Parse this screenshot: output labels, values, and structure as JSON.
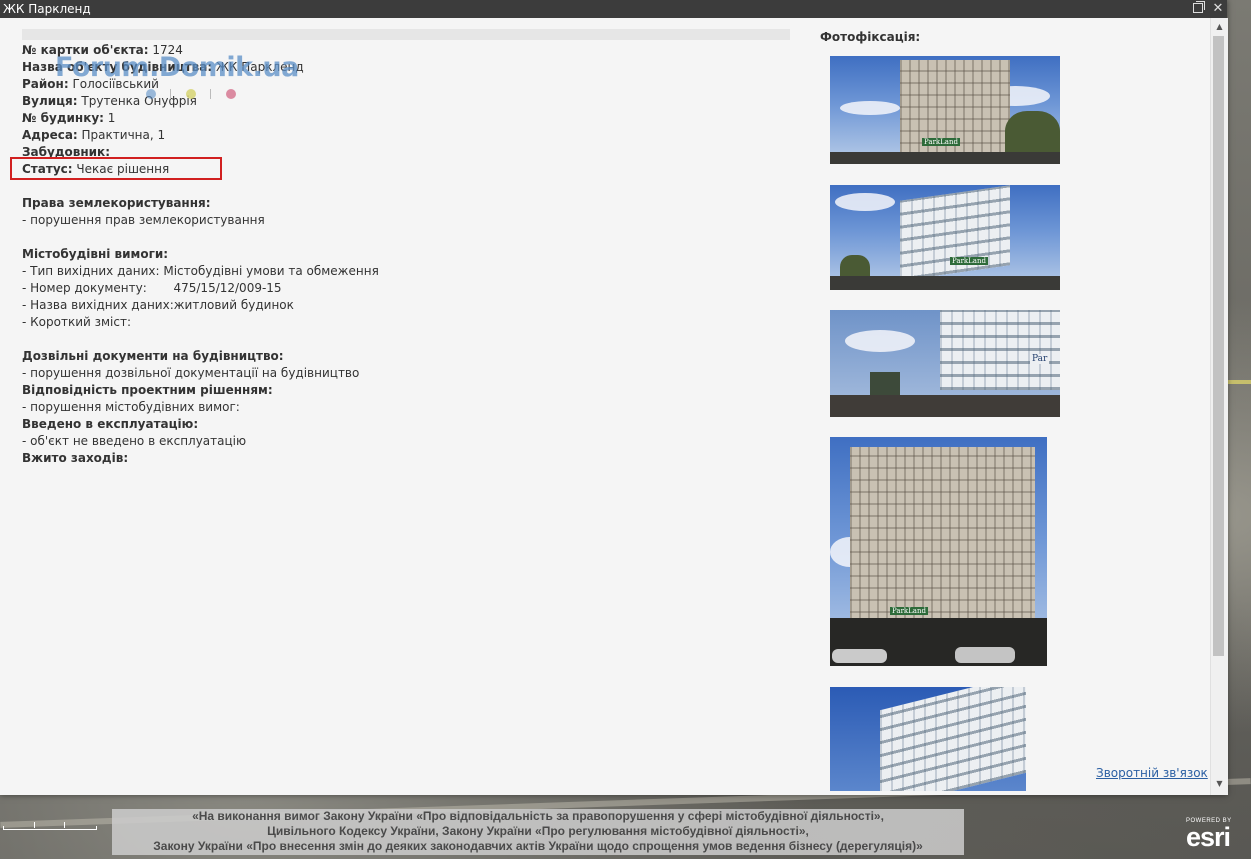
{
  "window": {
    "title": "ЖК Парклeнд",
    "maximize_icon": "restore-icon",
    "close_icon": "close-icon"
  },
  "watermark": {
    "text": "Forum.Domik.ua",
    "color": "#5b8fc7"
  },
  "info": {
    "card_number_label": "№ картки об'єкта:",
    "card_number_value": " 1724",
    "object_name_label": "Назва об'єкту будівництва:",
    "object_name_value": " ЖК Паркленд",
    "district_label": "Район:",
    "district_value": " Голосіївський",
    "street_label": "Вулиця:",
    "street_value": " Трутенка Онуфрія",
    "building_label": "№ будинку:",
    "building_value": " 1",
    "address_label": "Адреса:",
    "address_value": " Практична, 1",
    "developer_label": "Забудовник:",
    "status_label": "Статус:",
    "status_value": " Чекає рішення",
    "land_rights_heading": "Права землекористування:",
    "land_rights_item": "- порушення прав землекористування",
    "urban_requirements_heading": "Містобудівні вимоги:",
    "urban_type": "- Тип вихідних даних: Містобудівні умови та обмеження",
    "urban_doc_number": "- Номер документу:       475/15/12/009-15",
    "urban_name": "- Назва вихідних даних:житловий будинок",
    "urban_summary": "- Короткий зміст:",
    "permits_heading": "Дозвільні документи на будівництво:",
    "permits_item": "- порушення дозвільної документації на будівництво",
    "compliance_heading": "Відповідність проектним рішенням:",
    "compliance_item": "- порушення містобудівних вимог:",
    "commissioned_heading": "Введено в експлуатацію:",
    "commissioned_item": "- об'єкт не введено в експлуатацію",
    "measures_heading": "Вжито заходів:"
  },
  "photos": {
    "title": "Фотофіксація:",
    "items": [
      {
        "name": "photo-1",
        "sign": "ParkLand"
      },
      {
        "name": "photo-2",
        "sign": "ParkLand"
      },
      {
        "name": "photo-3",
        "sign": "Par"
      },
      {
        "name": "photo-4",
        "sign": "ParkLand"
      },
      {
        "name": "photo-5",
        "sign": ""
      }
    ]
  },
  "feedback_link": "Зворотній зв'язок",
  "footer": {
    "line1": "«На виконання вимог Закону України «Про відповідальність за правопорушення у сфері містобудівної діяльності»,",
    "line2": "Цивільного Кодексу України, Закону України «Про регулювання містобудівної діяльності»,",
    "line3": "Закону України «Про внесення змін до деяких законодавчих актів України щодо спрощення умов ведення бізнесу (дерегуляція)»"
  },
  "esri": {
    "powered_by": "POWERED BY",
    "logo": "esri"
  },
  "colors": {
    "titlebar": "#3c3c3c",
    "status_highlight": "#d12020",
    "link": "#2b5fa3"
  }
}
